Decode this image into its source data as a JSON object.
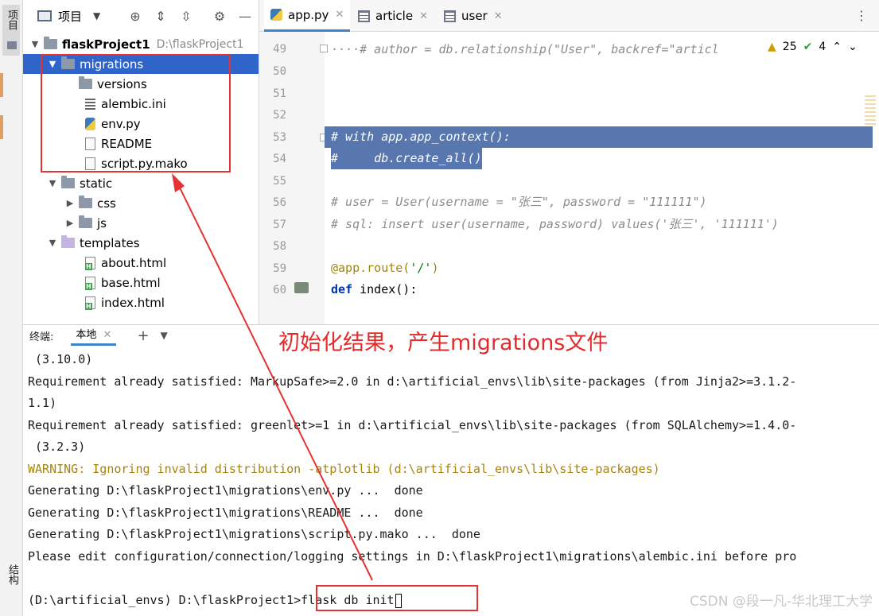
{
  "tool_strip": {
    "top_label": "项目",
    "bottom_label": "结构"
  },
  "project_panel": {
    "title": "项目",
    "tree": {
      "root": {
        "name": "flaskProject1",
        "path": "D:\\flaskProject1"
      },
      "migrations": "migrations",
      "versions": "versions",
      "alembic": "alembic.ini",
      "env": "env.py",
      "readme": "README",
      "script": "script.py.mako",
      "static": "static",
      "css": "css",
      "js": "js",
      "templates": "templates",
      "about": "about.html",
      "base": "base.html",
      "index": "index.html"
    }
  },
  "editor": {
    "tabs": [
      "app.py",
      "article",
      "user"
    ],
    "inspections": {
      "warnings": "25",
      "ok": "4"
    },
    "line_numbers": [
      "49",
      "50",
      "51",
      "52",
      "53",
      "54",
      "55",
      "56",
      "57",
      "58",
      "59",
      "60"
    ],
    "code": {
      "l49": "····# author = db.relationship(\"User\", backref=\"articl",
      "l53": "# with app.app_context():",
      "l54": "#     db.create_all()",
      "l56": "# user = User(username = \"张三\", password = \"111111\")",
      "l57": "# sql: insert user(username, password) values('张三', '111111')",
      "l59_dec": "@app.route(",
      "l59_str": "'/'",
      "l59_end": ")",
      "l60_kw": "def",
      "l60_rest": " index():"
    }
  },
  "terminal": {
    "tab_label": "终端:",
    "local_tab": "本地",
    "lines": {
      "t1": " (3.10.0)",
      "t2": "Requirement already satisfied: MarkupSafe>=2.0 in d:\\artificial_envs\\lib\\site-packages (from Jinja2>=3.1.2-",
      "t3": "1.1)",
      "t4": "Requirement already satisfied: greenlet>=1 in d:\\artificial_envs\\lib\\site-packages (from SQLAlchemy>=1.4.0-",
      "t5": " (3.2.3)",
      "t6": "WARNING: Ignoring invalid distribution -atplotlib (d:\\artificial_envs\\lib\\site-packages)",
      "t7": "Generating D:\\flaskProject1\\migrations\\env.py ...  done",
      "t8": "Generating D:\\flaskProject1\\migrations\\README ...  done",
      "t9": "Generating D:\\flaskProject1\\migrations\\script.py.mako ...  done",
      "t10": "Please edit configuration/connection/logging settings in D:\\flaskProject1\\migrations\\alembic.ini before pro"
    },
    "prompt": "(D:\\artificial_envs) D:\\flaskProject1>",
    "command": "flask db init"
  },
  "annotation": {
    "text": "初始化结果，产生migrations文件",
    "color": "#e42a2a"
  },
  "watermark": "CSDN @段一凡-华北理工大学"
}
